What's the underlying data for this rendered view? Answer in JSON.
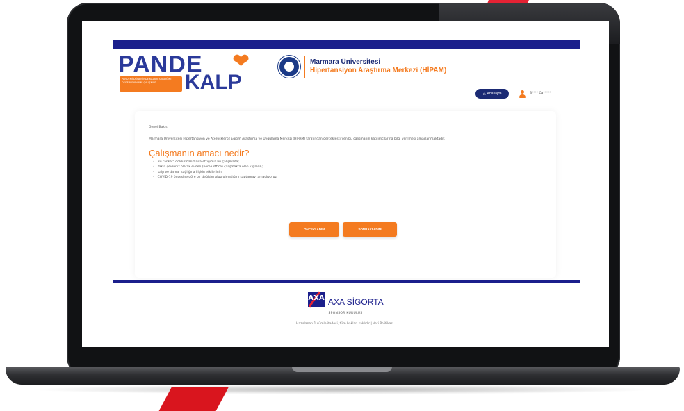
{
  "brand": {
    "logo_line1": "PANDE",
    "logo_line2": "KALP",
    "logo_tagline": "PANDEMİ DÖNEMİNDE KALBİN SAĞLIĞINI DEĞERLENDİRME ÇALIŞMASI"
  },
  "institution": {
    "name": "Marmara Üniversitesi",
    "center": "Hipertansiyon Araştırma Merkezi (HİPAM)"
  },
  "nav": {
    "home_label": "Anasayfa",
    "user_name": "B**** Ca*****"
  },
  "content": {
    "small_title": "Genel Bakış",
    "intro": "Marmara Üniversitesi Hipertansiyon ve Ateroskleroz Eğitim Araştırma ve Uygulama Merkezi (HİPAM) tarafından gerçekleştirilen bu çalışmanın katılımcılarına bilgi verilmesi amaçlanmaktadır.",
    "heading": "Çalışmanın amacı nedir?",
    "bullets": [
      "Bu \"anket\" doldurmanız rica ettiğimiz bu çalışmada;",
      "Yakın çevreniz olarak evden (home office) çalışmakta olan kişilerin;",
      "kalp ve damar sağlığına ilişkin etkilerinin,",
      "COVID-19 öncesine göre bir değişim olup olmadığını saptamayı amaçlıyoruz."
    ]
  },
  "buttons": {
    "prev_label": "ÖNCEKİ ADIM",
    "next_label": "SONRAKİ ADIM"
  },
  "footer": {
    "sponsor_name": "AXA SİGORTA",
    "sponsor_caption": "SPONSOR KURULUŞ",
    "note": "Hazırlanan 1 cümle ifadesi, tüm hakları saklıdır | Veri Politikası"
  },
  "colors": {
    "brand_blue": "#1b1f8c",
    "accent_orange": "#f47b20",
    "axa_red": "#e52234"
  },
  "icons": [
    "heart-icon",
    "university-seal-icon",
    "home-icon",
    "user-icon",
    "axa-logo-icon"
  ]
}
